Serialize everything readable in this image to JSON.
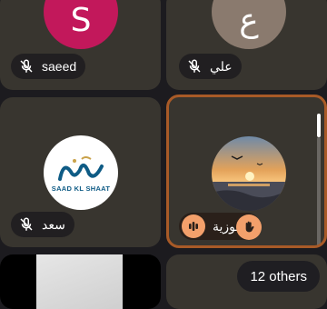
{
  "participants": [
    {
      "name": "saeed",
      "initial": "S",
      "avatar_color": "#c2185b",
      "mic": "muted"
    },
    {
      "name": "علي",
      "initial": "ع",
      "avatar_color": "#8a7a6e",
      "mic": "muted"
    },
    {
      "name": "سعد",
      "logo_text": "SAAD KL SHAAT",
      "mic": "muted"
    },
    {
      "name": "فوزية",
      "mic": "speaking",
      "hand_raised": true,
      "active": true
    }
  ],
  "others": {
    "label": "12 others"
  },
  "colors": {
    "tile_bg": "#38352f",
    "active_border": "#a85a27",
    "speaking_accent": "#f3a06b"
  }
}
